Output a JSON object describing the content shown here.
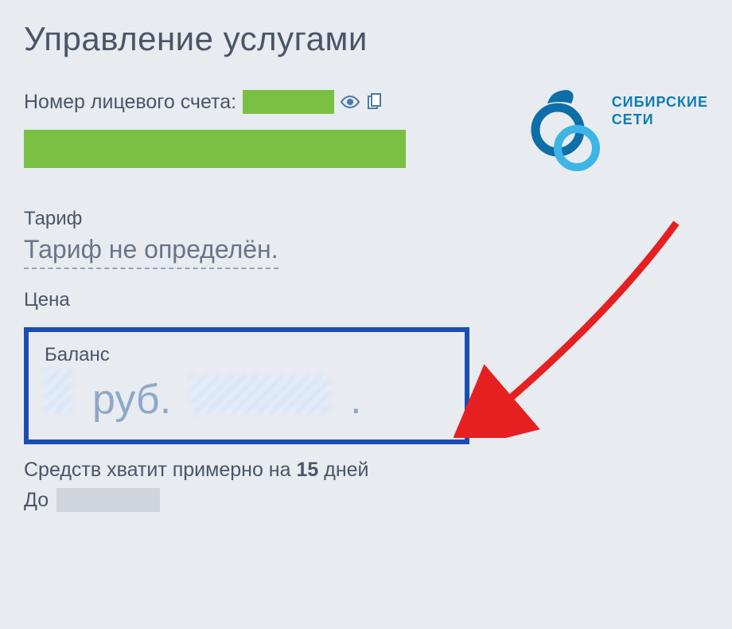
{
  "page": {
    "title": "Управление услугами"
  },
  "account": {
    "label": "Номер лицевого счета:"
  },
  "logo": {
    "line1": "СИБИРСКИЕ",
    "line2": "СЕТИ"
  },
  "tariff": {
    "label": "Тариф",
    "value": "Тариф не определён."
  },
  "price": {
    "label": "Цена"
  },
  "balance": {
    "label": "Баланс",
    "currency": "руб."
  },
  "funds": {
    "text_before": "Средств хватит примерно на ",
    "days": "15",
    "text_after": " дней"
  },
  "until": {
    "label": "До"
  }
}
